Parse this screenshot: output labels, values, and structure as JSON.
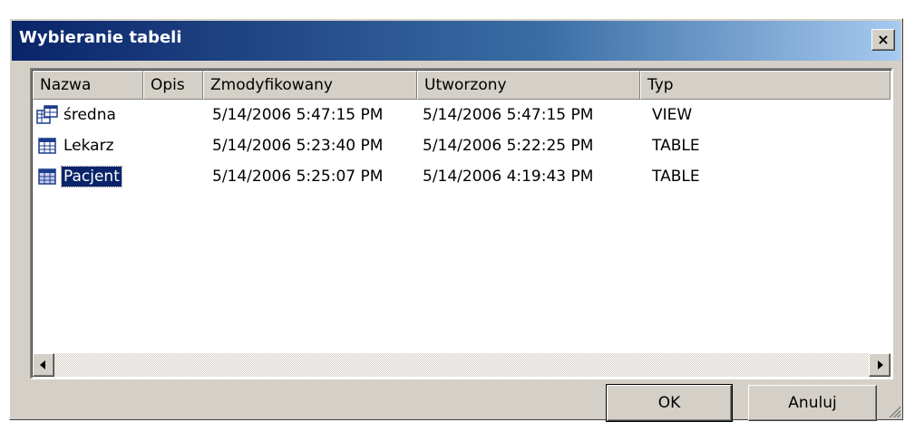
{
  "window": {
    "title": "Wybieranie tabeli",
    "close_label": "×"
  },
  "list": {
    "columns": [
      "Nazwa",
      "Opis",
      "Zmodyfikowany",
      "Utworzony",
      "Typ"
    ],
    "rows": [
      {
        "icon": "view-icon",
        "name": "średna",
        "description": "",
        "modified": "5/14/2006 5:47:15 PM",
        "created": "5/14/2006 5:47:15 PM",
        "type": "VIEW",
        "selected": false
      },
      {
        "icon": "table-icon",
        "name": "Lekarz",
        "description": "",
        "modified": "5/14/2006 5:23:40 PM",
        "created": "5/14/2006 5:22:25 PM",
        "type": "TABLE",
        "selected": false
      },
      {
        "icon": "table-icon",
        "name": "Pacjent",
        "description": "",
        "modified": "5/14/2006 5:25:07 PM",
        "created": "5/14/2006 4:19:43 PM",
        "type": "TABLE",
        "selected": true
      }
    ]
  },
  "buttons": {
    "ok": "OK",
    "cancel": "Anuluj"
  },
  "colors": {
    "titlebar_start": "#0a246a",
    "titlebar_end": "#a6caf0",
    "face": "#d4d0c8",
    "selection": "#0a246a"
  }
}
